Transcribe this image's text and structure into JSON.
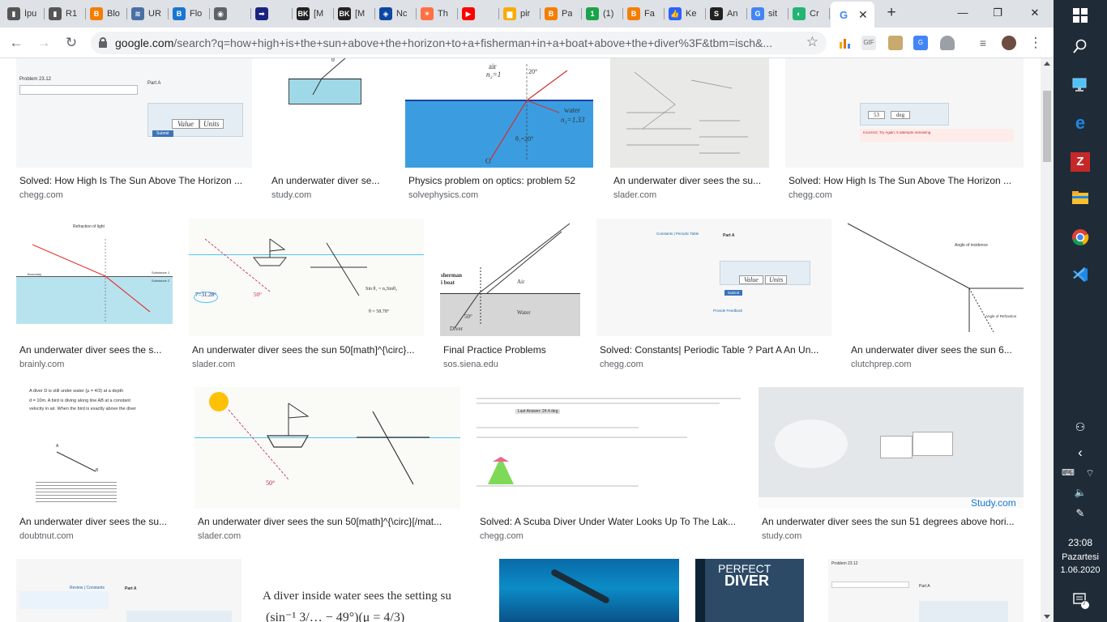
{
  "tabs": [
    {
      "label": "İpu",
      "icon": "site-icon",
      "color": "#555555"
    },
    {
      "label": "R1",
      "icon": "site-icon",
      "color": "#555555"
    },
    {
      "label": "Blo",
      "icon": "blogger-icon",
      "color": "#f57d00"
    },
    {
      "label": "UR",
      "icon": "wifi-icon",
      "color": "#4a6fa5"
    },
    {
      "label": "Flo",
      "icon": "b-icon",
      "color": "#1976d2"
    },
    {
      "label": "",
      "icon": "globe-icon",
      "color": "#5f6368"
    },
    {
      "label": "",
      "icon": "arrow-icon",
      "color": "#1a237e"
    },
    {
      "label": "[M",
      "icon": "bk-icon",
      "color": "#222222"
    },
    {
      "label": "[M",
      "icon": "bk-icon",
      "color": "#222222"
    },
    {
      "label": "Nc",
      "icon": "shield-icon",
      "color": "#0d47a1"
    },
    {
      "label": "Th",
      "icon": "star-icon",
      "color": "#ff7043"
    },
    {
      "label": "",
      "icon": "youtube-icon",
      "color": "#ff0000"
    },
    {
      "label": "pir",
      "icon": "chart-icon",
      "color": "#f9ab00"
    },
    {
      "label": "Pa",
      "icon": "blogger-icon",
      "color": "#f57d00"
    },
    {
      "label": "(1)",
      "icon": "one-icon",
      "color": "#1aa34a"
    },
    {
      "label": "Fa",
      "icon": "blogger-icon",
      "color": "#f57d00"
    },
    {
      "label": "Ke",
      "icon": "thumb-icon",
      "color": "#2962ff"
    },
    {
      "label": "An",
      "icon": "s-icon",
      "color": "#212121"
    },
    {
      "label": "sit",
      "icon": "google-icon",
      "color": "#4285f4"
    },
    {
      "label": "Cr",
      "icon": "cr-icon",
      "color": "#22b573"
    }
  ],
  "active_tab": {
    "icon": "google-icon",
    "close": "✕"
  },
  "new_tab": "+",
  "window": {
    "minimize": "—",
    "restore": "❐",
    "close": "✕"
  },
  "toolbar": {
    "back": "←",
    "forward": "→",
    "reload": "↻",
    "url_host": "google.com",
    "url_rest": "/search?q=how+high+is+the+sun+above+the+horizon+to+a+fisherman+in+a+boat+above+the+diver%3F&tbm=isch&...",
    "star": "☆",
    "menu": "⋮"
  },
  "results": [
    {
      "caption": "Solved: How High Is The Sun Above The Horizon ...",
      "source": "chegg.com"
    },
    {
      "caption": "An underwater diver se...",
      "source": "study.com"
    },
    {
      "caption": "Physics problem on optics: problem 52",
      "source": "solvephysics.com"
    },
    {
      "caption": "An underwater diver sees the su...",
      "source": "slader.com"
    },
    {
      "caption": "Solved: How High Is The Sun Above The Horizon ...",
      "source": "chegg.com"
    },
    {
      "caption": "An underwater diver sees the s...",
      "source": "brainly.com"
    },
    {
      "caption": "An underwater diver sees the sun 50[math]^{\\circ}...",
      "source": "slader.com"
    },
    {
      "caption": "Final Practice Problems",
      "source": "sos.siena.edu"
    },
    {
      "caption": "Solved: Constants| Periodic Table ? Part A An Un...",
      "source": "chegg.com"
    },
    {
      "caption": "An underwater diver sees the sun 6...",
      "source": "clutchprep.com"
    },
    {
      "caption": "An underwater diver sees the su...",
      "source": "doubtnut.com"
    },
    {
      "caption": "An underwater diver sees the sun 50[math]^{\\circ}[/mat...",
      "source": "slader.com"
    },
    {
      "caption": "Solved: A Scuba Diver Under Water Looks Up To The Lak...",
      "source": "chegg.com"
    },
    {
      "caption": "An underwater diver sees the sun 51 degrees above hori...",
      "source": "study.com"
    }
  ],
  "thumb_text": {
    "t1_problem": "Problem 23.12",
    "t1_parta": "Part A",
    "t1_value": "Value",
    "t1_units": "Units",
    "t1_submit": "Submit",
    "t2_theta": "θ",
    "t3_air": "air",
    "t3_n2": "n₂=1",
    "t3_angle": "20°",
    "t3_water": "water",
    "t3_n1": "n₁=1.33",
    "t3_o": "O",
    "t3_theta1": "θ₁=20°",
    "t5_value": "53",
    "t5_unit": "deg",
    "t5_wrong": "Incorrect; Try Again; 5 attempts remaining",
    "t6_title": "Refraction of light",
    "t6_boundary": "Boundary",
    "t6_s1": "Substance 1",
    "t6_s2": "Substance 2",
    "t7_deg": "50°",
    "t7_eq1": "Sin θ₁ = n₂Sinθ₂",
    "t7_eq2": "θ = 58.78°",
    "t7_ans": "7=31.28°",
    "t8_fisherman": "sherman",
    "t8_boat": "i boat",
    "t8_air": "Air",
    "t8_water": "Water",
    "t8_diver": "Diver",
    "t8_deg": "50°",
    "t9_constants": "Constants | Periodic Table",
    "t9_parta": "Part A",
    "t9_value": "Value",
    "t9_units": "Units",
    "t9_submit": "Submit",
    "t9_feedback": "Provide Feedback",
    "t10_incidence": "Angle of incidence",
    "t10_refraction": "Angle of Refraction",
    "t11_text": "A diver D is still under water (μ = 4/3) at a depth",
    "t11_d": "d = 10m. A bird is diving along line AB at a constant",
    "t11_text2": "velocity in air. When the bird is exactly above the diver",
    "t11_a": "A",
    "t11_b": "B",
    "t12_deg": "50°",
    "t13_answer": "Last Answer: 24.4 deg",
    "t14_watermark": "Study.com",
    "t15_review": "Review | Constants",
    "t15_parta": "Part A",
    "t16_text": "A diver inside water sees the setting su",
    "t16_formula": "(sin⁻¹ 3/… − 49°)(μ = 4/3)",
    "t18_title": "PERFECT",
    "t18_title2": "DIVER",
    "t19_problem": "Problem 23.12",
    "t19_parta": "Part A"
  },
  "taskbar": {
    "time": "23:08",
    "day": "Pazartesi",
    "date": "1.06.2020",
    "notification_count": "7"
  }
}
